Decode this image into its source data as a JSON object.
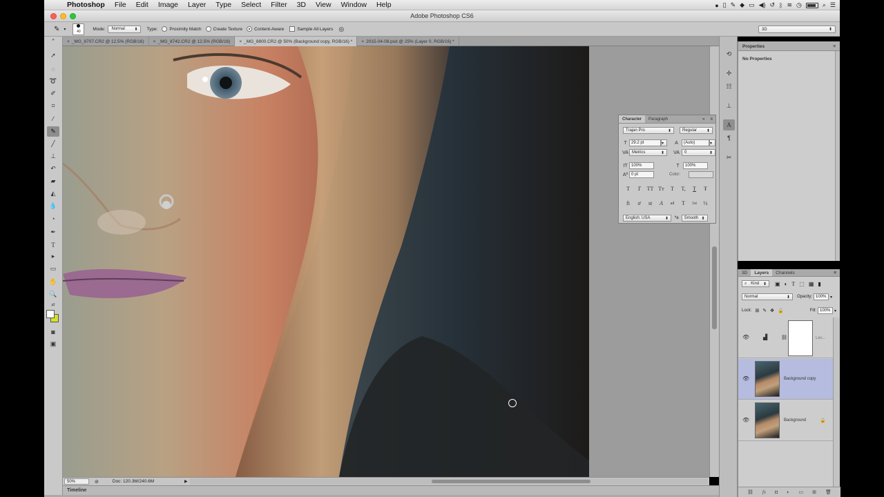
{
  "menubar": {
    "app_name": "Photoshop",
    "menus": [
      "File",
      "Edit",
      "Image",
      "Layer",
      "Type",
      "Select",
      "Filter",
      "3D",
      "View",
      "Window",
      "Help"
    ]
  },
  "window": {
    "title": "Adobe Photoshop CS6"
  },
  "options_bar": {
    "brush_size": "40",
    "mode_label": "Mode:",
    "mode_value": "Normal",
    "type_label": "Type:",
    "type_options": [
      "Proximity Match",
      "Create Texture",
      "Content-Aware"
    ],
    "selected_type": "Content-Aware",
    "sample_all_layers": "Sample All Layers",
    "workspace": "3D"
  },
  "tabs": [
    "_MG_8707.CR2 @ 12.5% (RGB/16)",
    "_MG_8742.CR2 @ 12.5% (RGB/16)",
    "_MG_8800.CR2 @ 50% (Background copy, RGB/16) *",
    "2015-04-08.psd @ 25% (Layer 0, RGB/16) *"
  ],
  "status_bar": {
    "zoom": "50%",
    "doc_info": "Doc: 120.3M/240.6M"
  },
  "timeline": {
    "label": "Timeline"
  },
  "properties": {
    "title": "Properties",
    "empty_text": "No Properties"
  },
  "character": {
    "tabs": [
      "Character",
      "Paragraph"
    ],
    "font_family": "Trajan Pro",
    "font_style": "Regular",
    "size": "29.2 pt",
    "leading": "(Auto)",
    "kerning": "Metrics",
    "tracking": "0",
    "vertical_scale": "100%",
    "horizontal_scale": "100%",
    "baseline_shift": "0 pt",
    "color_label": "Color:",
    "language": "English: USA",
    "aa_label": "a",
    "antialias": "Smooth",
    "type_buttons": [
      "T",
      "T",
      "TT",
      "Tт",
      "T",
      "T,",
      "T",
      "Ŧ"
    ],
    "opentype_buttons": [
      "fi",
      "ơ",
      "st",
      "A",
      "ad",
      "T",
      "1st",
      "½"
    ]
  },
  "layers_panel": {
    "tabs": [
      "3D",
      "Layers",
      "Channels"
    ],
    "filter_kind": "Kind",
    "blend_mode": "Normal",
    "opacity_label": "Opacity:",
    "opacity": "100%",
    "lock_label": "Lock:",
    "fill_label": "Fill:",
    "fill": "100%",
    "layers": [
      {
        "name": "Lev...",
        "type": "adjustment"
      },
      {
        "name": "Background copy",
        "type": "pixel",
        "selected": true
      },
      {
        "name": "Background",
        "type": "pixel",
        "locked": true
      }
    ]
  },
  "colors": {
    "selected_layer": "#b6bcdf",
    "panel_bg": "#cdcdcd",
    "foreground_color": "#ffffff",
    "background_color": "#d6e02c"
  }
}
